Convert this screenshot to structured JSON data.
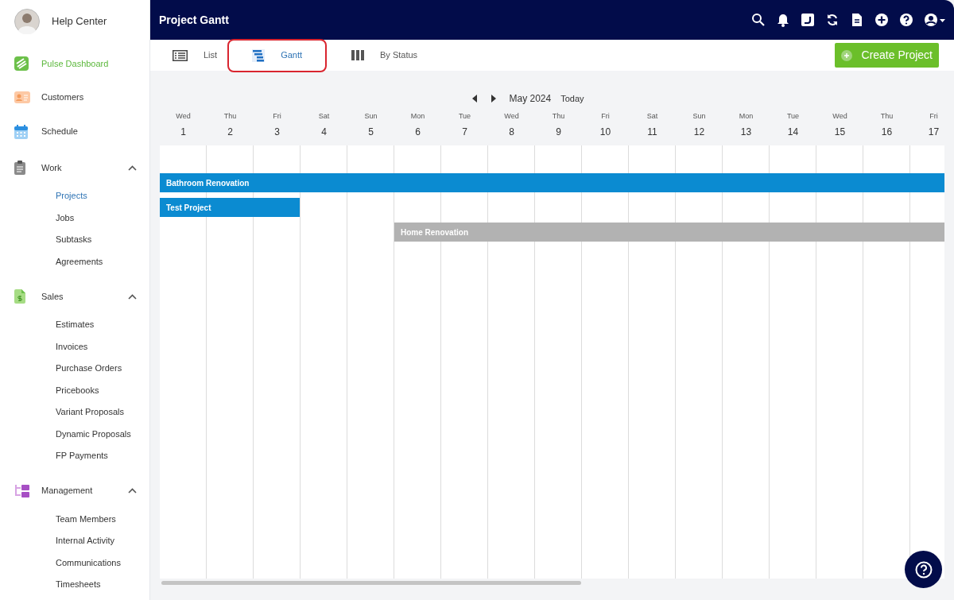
{
  "sidebar": {
    "user": {
      "name": "Help Center"
    },
    "items": [
      {
        "kind": "link",
        "label": "Pulse Dashboard",
        "selected": true
      },
      {
        "kind": "link",
        "label": "Customers",
        "selected": false
      },
      {
        "kind": "link",
        "label": "Schedule",
        "selected": false
      },
      {
        "kind": "group",
        "label": "Work",
        "expanded": true,
        "children": [
          {
            "label": "Projects",
            "selected": true
          },
          {
            "label": "Jobs",
            "selected": false
          },
          {
            "label": "Subtasks",
            "selected": false
          },
          {
            "label": "Agreements",
            "selected": false
          }
        ]
      },
      {
        "kind": "group",
        "label": "Sales",
        "expanded": true,
        "children": [
          {
            "label": "Estimates",
            "selected": false
          },
          {
            "label": "Invoices",
            "selected": false
          },
          {
            "label": "Purchase Orders",
            "selected": false
          },
          {
            "label": "Pricebooks",
            "selected": false
          },
          {
            "label": "Variant Proposals",
            "selected": false
          },
          {
            "label": "Dynamic Proposals",
            "selected": false
          },
          {
            "label": "FP Payments",
            "selected": false
          }
        ]
      },
      {
        "kind": "group",
        "label": "Management",
        "expanded": true,
        "children": [
          {
            "label": "Team Members",
            "selected": false
          },
          {
            "label": "Internal Activity",
            "selected": false
          },
          {
            "label": "Communications",
            "selected": false
          },
          {
            "label": "Timesheets",
            "selected": false
          }
        ]
      }
    ]
  },
  "header": {
    "title": "Project Gantt"
  },
  "view_tabs": [
    {
      "kind": "list",
      "label": "List",
      "selected": false,
      "highlighted": false
    },
    {
      "kind": "gantt",
      "label": "Gantt",
      "selected": true,
      "highlighted": true
    },
    {
      "kind": "status",
      "label": "By Status",
      "selected": false,
      "highlighted": false
    }
  ],
  "create_button": {
    "label": "Create Project"
  },
  "calendar": {
    "month": "May 2024",
    "today_button": "Today",
    "days": [
      {
        "weekday": "Wed",
        "day": "1"
      },
      {
        "weekday": "Thu",
        "day": "2"
      },
      {
        "weekday": "Fri",
        "day": "3"
      },
      {
        "weekday": "Sat",
        "day": "4"
      },
      {
        "weekday": "Sun",
        "day": "5"
      },
      {
        "weekday": "Mon",
        "day": "6"
      },
      {
        "weekday": "Tue",
        "day": "7"
      },
      {
        "weekday": "Wed",
        "day": "8"
      },
      {
        "weekday": "Thu",
        "day": "9"
      },
      {
        "weekday": "Fri",
        "day": "10"
      },
      {
        "weekday": "Sat",
        "day": "11"
      },
      {
        "weekday": "Sun",
        "day": "12"
      },
      {
        "weekday": "Mon",
        "day": "13"
      },
      {
        "weekday": "Tue",
        "day": "14"
      },
      {
        "weekday": "Wed",
        "day": "15"
      },
      {
        "weekday": "Thu",
        "day": "16"
      },
      {
        "weekday": "Fri",
        "day": "17"
      }
    ],
    "bars": [
      {
        "label": "Bathroom Renovation",
        "color": "#0b8bd1"
      },
      {
        "label": "Test Project",
        "color": "#0b8bd1"
      },
      {
        "label": "Home Renovation",
        "color": "#b2b2b2"
      }
    ]
  }
}
